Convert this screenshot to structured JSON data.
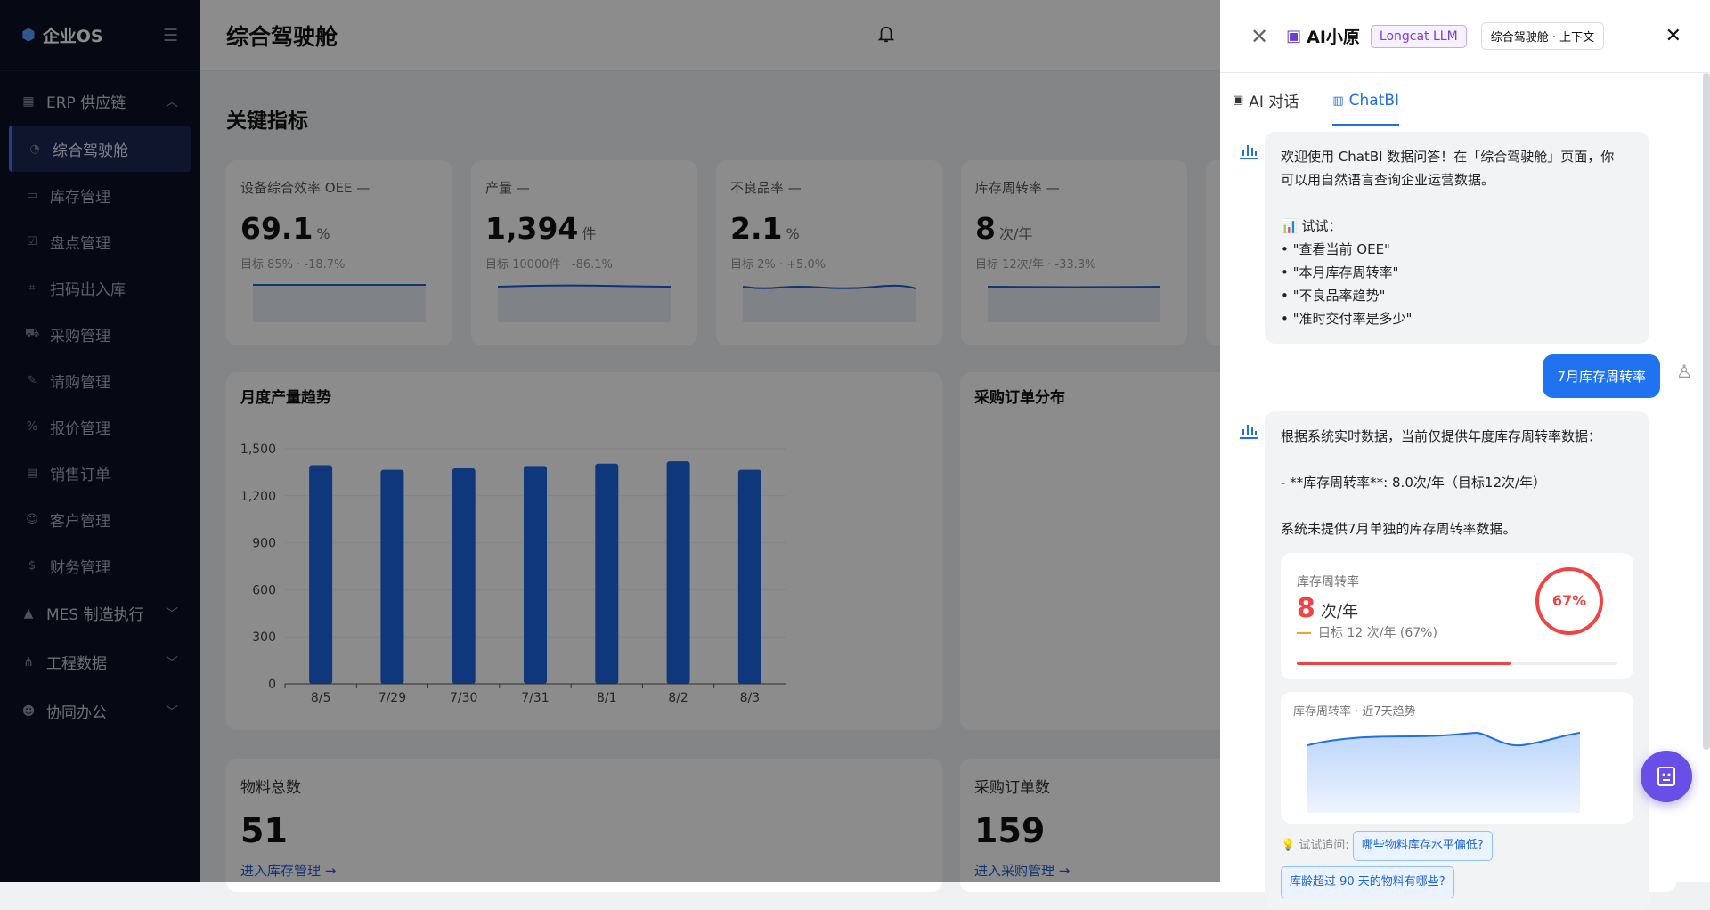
{
  "sidebar": {
    "logo": "企业OS",
    "groups": [
      {
        "label": "ERP 供应链"
      },
      {
        "label": "MES 制造执行"
      },
      {
        "label": "工程数据"
      },
      {
        "label": "协同办公"
      }
    ],
    "items": [
      {
        "label": "综合驾驶舱"
      },
      {
        "label": "库存管理"
      },
      {
        "label": "盘点管理"
      },
      {
        "label": "扫码出入库"
      },
      {
        "label": "采购管理"
      },
      {
        "label": "请购管理"
      },
      {
        "label": "报价管理"
      },
      {
        "label": "销售订单"
      },
      {
        "label": "客户管理"
      },
      {
        "label": "财务管理"
      }
    ]
  },
  "header": {
    "title": "综合驾驶舱"
  },
  "main": {
    "section_title": "关键指标",
    "kpis": [
      {
        "title": "设备综合效率 OEE —",
        "value": "69.1",
        "unit": "%",
        "sub": "目标 85% · -18.7%"
      },
      {
        "title": "产量 —",
        "value": "1,394",
        "unit": "件",
        "sub": "目标 10000件 · -86.1%"
      },
      {
        "title": "不良品率 —",
        "value": "2.1",
        "unit": "%",
        "sub": "目标 2% · +5.0%"
      },
      {
        "title": "库存周转率 —",
        "value": "8",
        "unit": "次/年",
        "sub": "目标 12次/年 · -33.3%"
      }
    ],
    "chart_title": "月度产量趋势",
    "order_chart_title": "采购订单分布",
    "bottom": [
      {
        "title": "物料总数",
        "value": "51",
        "link": "进入库存管理 →"
      },
      {
        "title": "采购订单数",
        "value": "159",
        "link": "进入采购管理 →"
      }
    ]
  },
  "chart_data": {
    "type": "bar",
    "title": "月度产量趋势",
    "categories": [
      "8/5",
      "7/29",
      "7/30",
      "7/31",
      "8/1",
      "8/2",
      "8/3"
    ],
    "values": [
      1395,
      1366,
      1375,
      1390,
      1405,
      1420,
      1366
    ],
    "ylim": [
      0,
      1500
    ],
    "yticks": [
      "0",
      "300",
      "600",
      "900",
      "1,200",
      "1,500"
    ],
    "color": "#1a66e0"
  },
  "panel": {
    "name": "AI小原",
    "model_tag": "Longcat LLM",
    "context_tag": "综合驾驶舱 · 上下文",
    "tabs": [
      {
        "label": "AI 对话"
      },
      {
        "label": "ChatBI"
      }
    ],
    "welcome": [
      "欢迎使用 ChatBI 数据问答！在「综合驾驶舱」页面，你",
      "可以用自然语言查询企业运营数据。",
      "",
      "📊 试试：",
      "• \"查看当前 OEE\"",
      "• \"本月库存周转率\"",
      "• \"不良品率趋势\"",
      "• \"准时交付率是多少\""
    ],
    "user_msg": "7月库存周转率",
    "answer": [
      "根据系统实时数据，当前仅提供年度库存周转率数据：",
      "",
      "- **库存周转率**: 8.0次/年（目标12次/年）",
      "",
      "系统未提供7月单独的库存周转率数据。"
    ],
    "metric": {
      "title": "库存周转率",
      "value": "8",
      "unit": "次/年",
      "target": "目标 12 次/年 (67%)",
      "percent": "67%",
      "fill": 0.67
    },
    "trend_title": "库存周转率 · 近7天趋势",
    "follow_label": "试试追问:",
    "chips": [
      "哪些物料库存水平偏低?",
      "库龄超过 90 天的物料有哪些?"
    ]
  }
}
